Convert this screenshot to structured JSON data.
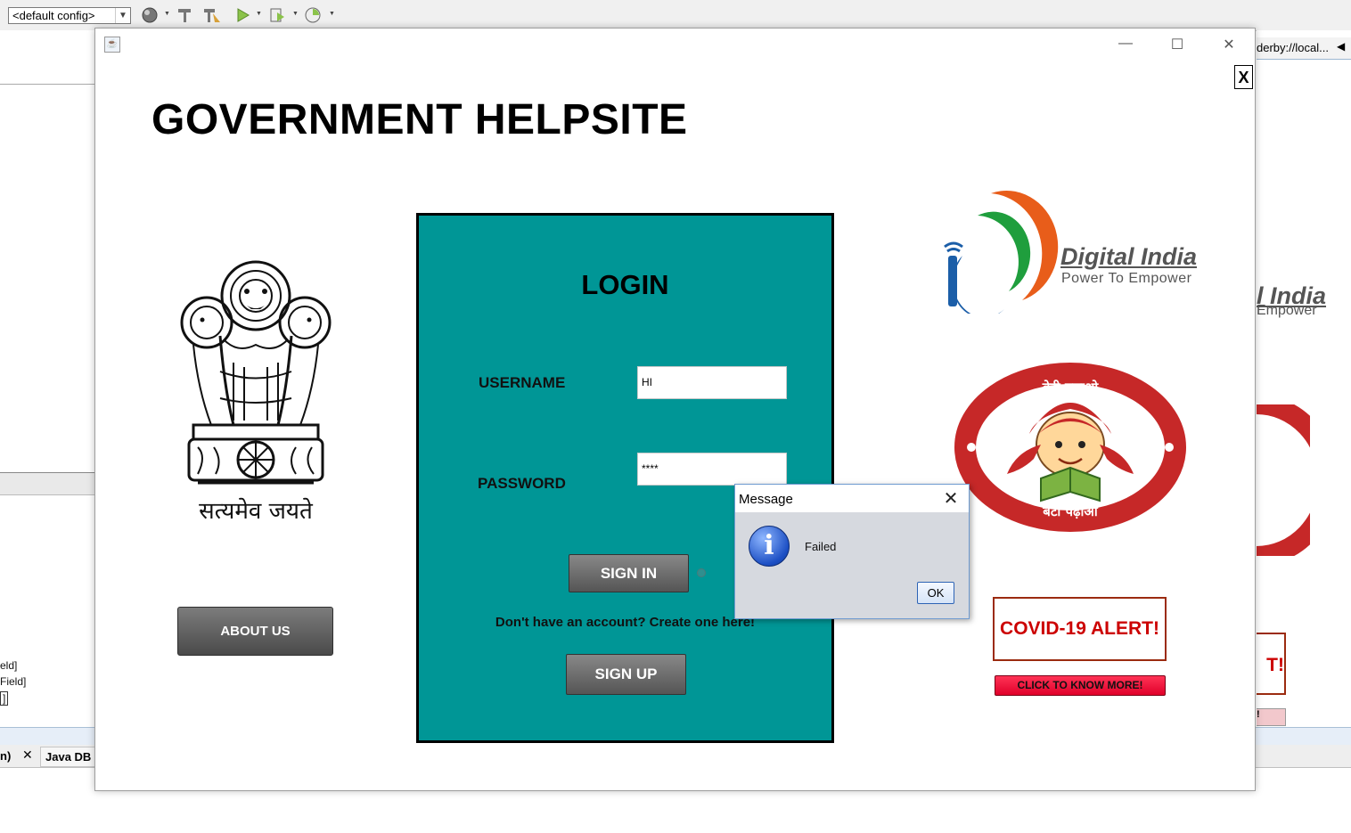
{
  "ide": {
    "config_select": "<default config>",
    "right_header": "derby://local...",
    "left_lines": [
      "eld]",
      "Field]",
      "]"
    ],
    "bottom_tab_1": "n)",
    "bottom_tab_2": "Java DB",
    "right_ghost_logo": "l India",
    "right_ghost_tag": "Empower",
    "right_ghost_alert": "T!",
    "right_ghost_btn": "!"
  },
  "app": {
    "title": "GOVERNMENT HELPSITE",
    "close_label": "X",
    "motto": "सत्यमेव जयते",
    "about_button": "ABOUT US",
    "login": {
      "heading": "LOGIN",
      "username_label": "USERNAME",
      "username_value": "HI",
      "password_label": "PASSWORD",
      "password_value": "****",
      "sign_in": "SIGN IN",
      "create_text": "Don't have an account? Create one here!",
      "sign_up": "SIGN UP"
    },
    "digital_india": {
      "name": "Digital India",
      "tagline": "Power To Empower"
    },
    "beti": {
      "top": "बेटी बचाओ",
      "bottom": "बेटी पढ़ाओ"
    },
    "covid": {
      "alert": "COVID-19 ALERT!",
      "button": "CLICK TO KNOW MORE!"
    }
  },
  "dialog": {
    "title": "Message",
    "message": "Failed",
    "ok": "OK"
  },
  "colors": {
    "login_panel": "#009696",
    "covid_red": "#cc0000",
    "know_button": "#ff1744",
    "di_orange": "#e85d1a",
    "di_green": "#1f9e3d",
    "di_blue": "#1b5ea8"
  }
}
